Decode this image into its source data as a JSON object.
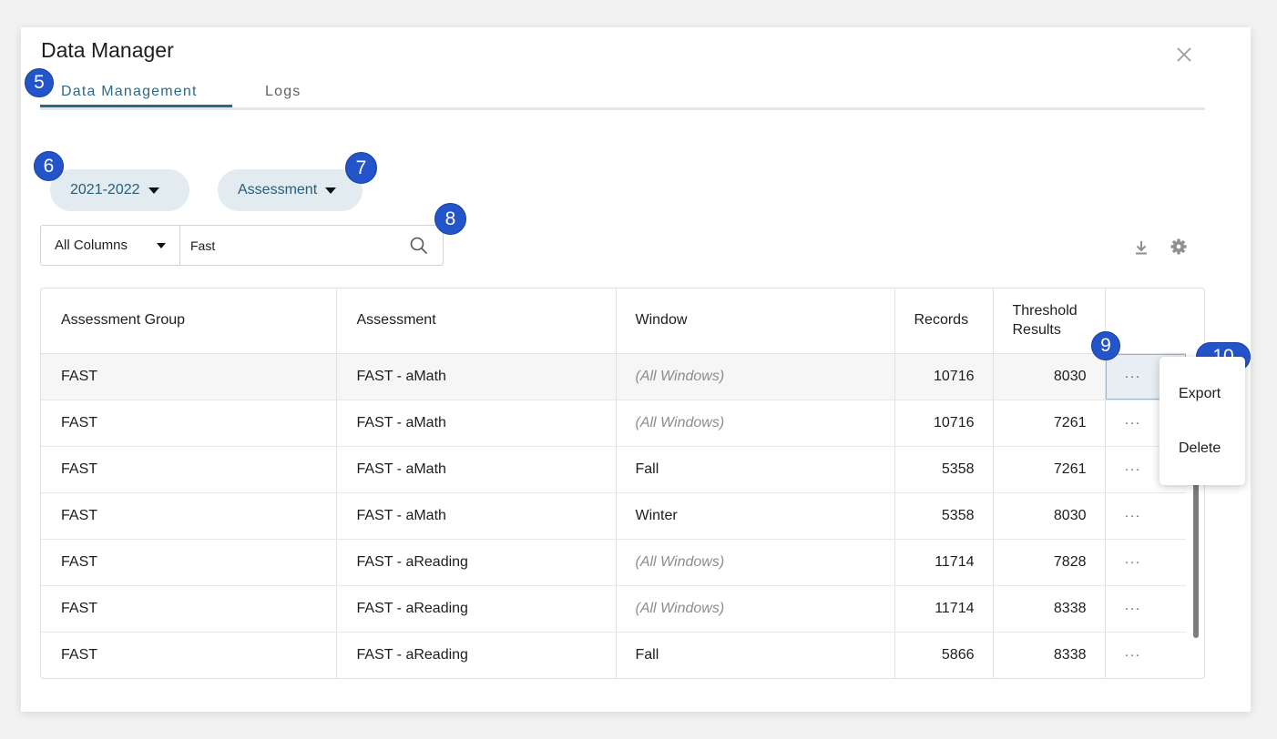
{
  "modal": {
    "title": "Data Manager"
  },
  "tabs": [
    {
      "label": "Data Management",
      "active": true
    },
    {
      "label": "Logs",
      "active": false
    }
  ],
  "filters": {
    "year": "2021-2022",
    "type": "Assessment"
  },
  "search": {
    "column": "All Columns",
    "value": "Fast"
  },
  "badges": {
    "b5": "5",
    "b6": "6",
    "b7": "7",
    "b8": "8",
    "b9": "9",
    "b10": "10"
  },
  "table": {
    "headers": [
      "Assessment Group",
      "Assessment",
      "Window",
      "Records",
      "Threshold Results"
    ],
    "rows": [
      {
        "group": "FAST",
        "assessment": "FAST - aMath",
        "window": "(All Windows)",
        "records": "10716",
        "threshold": "8030",
        "more": "···"
      },
      {
        "group": "FAST",
        "assessment": "FAST - aMath",
        "window": "(All Windows)",
        "records": "10716",
        "threshold": "7261",
        "more": "···"
      },
      {
        "group": "FAST",
        "assessment": "FAST - aMath",
        "window": "Fall",
        "records": "5358",
        "threshold": "7261",
        "more": "···"
      },
      {
        "group": "FAST",
        "assessment": "FAST - aMath",
        "window": "Winter",
        "records": "5358",
        "threshold": "8030",
        "more": "···"
      },
      {
        "group": "FAST",
        "assessment": "FAST - aReading",
        "window": "(All Windows)",
        "records": "11714",
        "threshold": "7828",
        "more": "···"
      },
      {
        "group": "FAST",
        "assessment": "FAST - aReading",
        "window": "(All Windows)",
        "records": "11714",
        "threshold": "8338",
        "more": "···"
      },
      {
        "group": "FAST",
        "assessment": "FAST - aReading",
        "window": "Fall",
        "records": "5866",
        "threshold": "8338",
        "more": "···"
      }
    ]
  },
  "row_menu": {
    "export": "Export",
    "delete": "Delete"
  },
  "icons": {
    "close": "close-icon",
    "search": "search-icon",
    "download": "download-icon",
    "settings": "gear-icon"
  },
  "colors": {
    "accent": "#2d6987",
    "pill_bg": "#e1ebf0",
    "badge": "#2354c9"
  }
}
